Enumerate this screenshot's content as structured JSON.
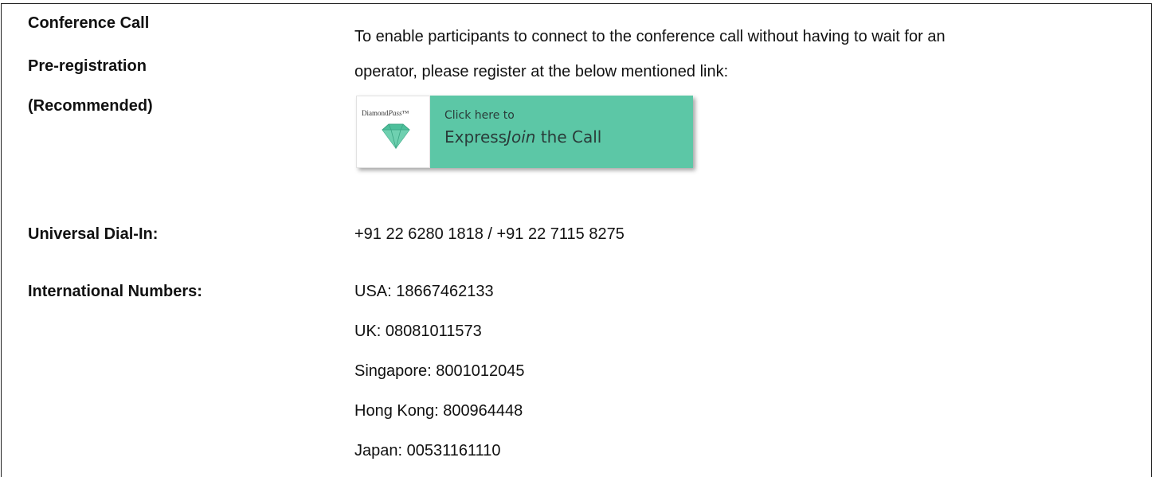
{
  "preregistration": {
    "label_line1": "Conference Call",
    "label_line2": "Pre-registration",
    "label_line3": "(Recommended)",
    "description_line1": "To enable participants to connect to the conference call without having to wait for an",
    "description_line2": "operator, please register at the below mentioned link:",
    "banner": {
      "logo_brand": "Diamond",
      "logo_pass": "Pass",
      "logo_tm": "™",
      "click_text": "Click here to",
      "join_prefix": "Express",
      "join_italic": "Join",
      "join_suffix": " the Call",
      "logo_icon": "diamond-icon",
      "bg_color": "#5cc7a6",
      "gem_color": "#4dbf9b"
    }
  },
  "universal_dial_in": {
    "label": "Universal Dial-In:",
    "value": "+91 22 6280 1818 / +91 22 7115 8275"
  },
  "international": {
    "label": "International Numbers:",
    "numbers": [
      "USA: 18667462133",
      "UK: 08081011573",
      "Singapore: 8001012045",
      "Hong Kong: 800964448",
      "Japan: 00531161110"
    ]
  }
}
